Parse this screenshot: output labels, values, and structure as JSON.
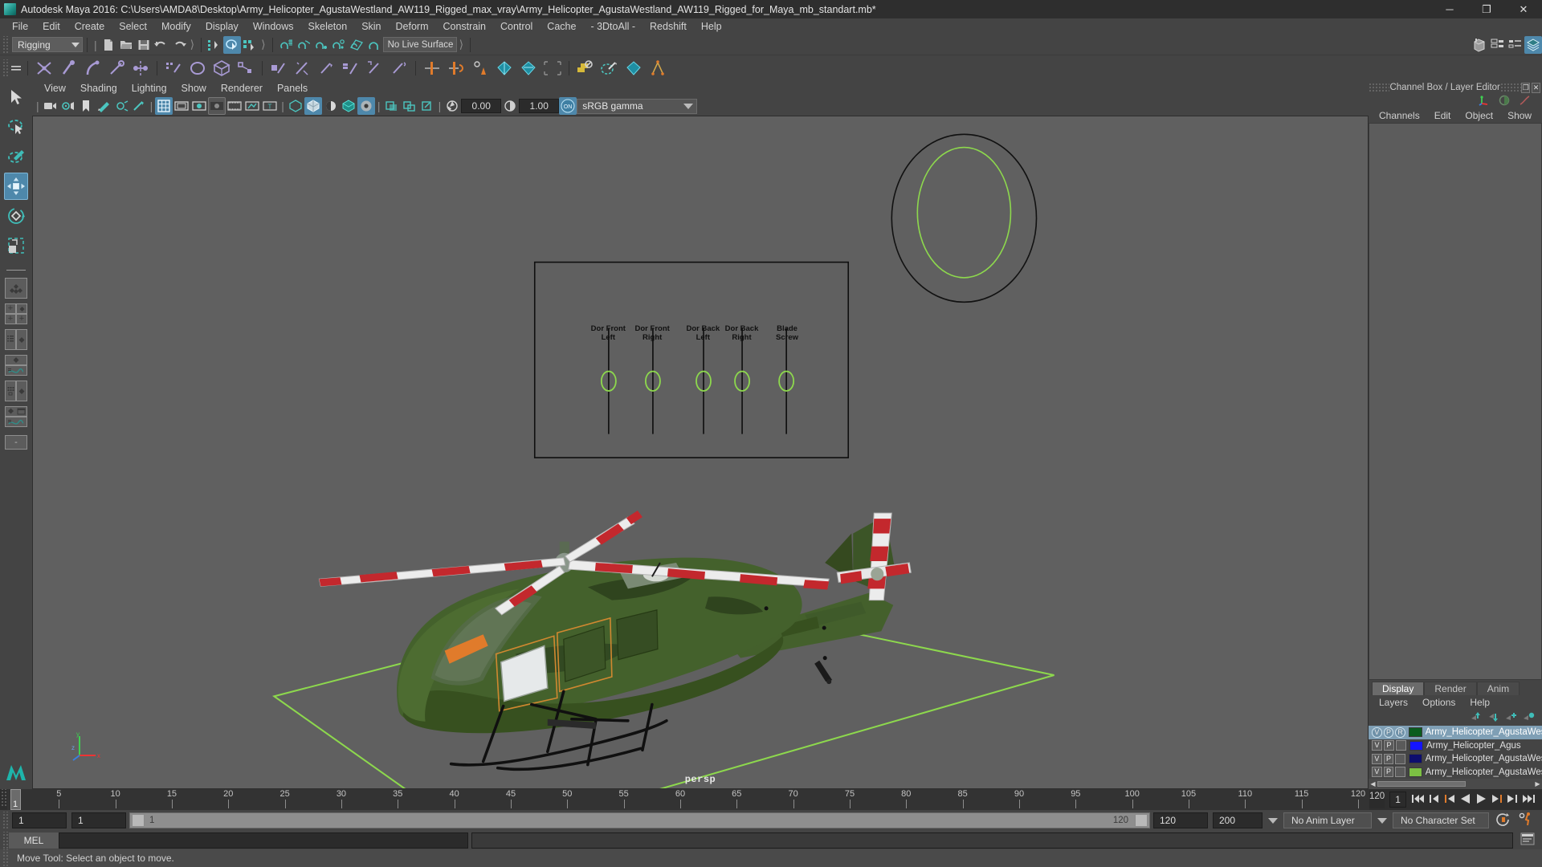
{
  "titlebar": {
    "app_title": "Autodesk Maya 2016: C:\\Users\\AMDA8\\Desktop\\Army_Helicopter_AgustaWestland_AW119_Rigged_max_vray\\Army_Helicopter_AgustaWestland_AW119_Rigged_for_Maya_mb_standart.mb*",
    "minimize": "─",
    "maximize": "❐",
    "close": "✕"
  },
  "menubar": {
    "items": [
      "File",
      "Edit",
      "Create",
      "Select",
      "Modify",
      "Display",
      "Windows",
      "Skeleton",
      "Skin",
      "Deform",
      "Constrain",
      "Control",
      "Cache",
      "- 3DtoAll -",
      "Redshift",
      "Help"
    ]
  },
  "statusline": {
    "menu_set": "Rigging",
    "live_surface": "No Live Surface",
    "icons": [
      "new-scene-icon",
      "open-scene-icon",
      "save-scene-icon",
      "undo-icon",
      "redo-icon",
      "select-by-hierarchy-icon",
      "select-by-object-type-icon",
      "select-by-component-type-icon",
      "snap-to-grid-icon",
      "snap-to-curve-icon",
      "snap-to-point-icon",
      "snap-to-projected-center-icon",
      "snap-to-view-plane-icon",
      "make-live-icon",
      "show-editors-icon",
      "render-view-icon",
      "ipr-render-icon",
      "render-settings-icon",
      "toggle-sidebar-attribute-icon",
      "toggle-sidebar-tool-icon",
      "toggle-sidebar-channel-icon",
      "toggle-sidebar-layer-icon"
    ]
  },
  "shelfbar": {
    "icons": [
      "create-joint-icon",
      "ik-handle-icon",
      "ik-spline-handle-icon",
      "insert-joint-icon",
      "mirror-joint-icon",
      "skeleton-generator-icon",
      "quick-rig-icon",
      "lattice-icon",
      "wrap-icon",
      "cluster-icon",
      "bind-skin-icon",
      "detach-skin-icon",
      "paint-skin-weights-icon",
      "mirror-skin-weights-icon",
      "copy-skin-weights-icon",
      "smooth-skin-icon",
      "parent-constraint-icon",
      "point-constraint-icon",
      "orient-constraint-icon",
      "scale-constraint-icon",
      "aim-constraint-icon",
      "pole-vector-icon",
      "full-body-ik-icon",
      "character-set-icon"
    ]
  },
  "toolbox": {
    "tools": [
      "select-tool",
      "lasso-select-tool",
      "paint-select-tool",
      "move-tool",
      "rotate-tool",
      "scale-tool"
    ],
    "selected_tool": "move-tool",
    "layouts": [
      "single-perspective-layout",
      "four-view-layout",
      "outliner-persp-layout",
      "persp-graph-layout",
      "hypershade-persp-layout",
      "persp-graph-outliner-layout"
    ]
  },
  "viewport_menu": {
    "items": [
      "View",
      "Shading",
      "Lighting",
      "Show",
      "Renderer",
      "Panels"
    ]
  },
  "viewport_toolbar": {
    "exposure_value": "0.00",
    "gamma_value": "1.00",
    "view_transform": "sRGB gamma",
    "color_mgmt_toggle": "ON",
    "icons": [
      "select-camera-icon",
      "camera-attributes-icon",
      "bookmark-icon",
      "image-plane-icon",
      "two-sided-lighting-icon",
      "shadows-icon",
      "grid-icon",
      "film-gate-icon",
      "resolution-gate-icon",
      "gate-mask-icon",
      "film-origin-icon",
      "xray-icon",
      "texture-icon",
      "wireframe-icon",
      "smooth-shade-icon",
      "shaded-and-textured-icon",
      "lights-icon",
      "xray-joints-icon",
      "isolate-select-icon",
      "panel-zoom-icon",
      "ipr-icon"
    ]
  },
  "viewport": {
    "camera_label": "persp",
    "control_panel_labels": [
      {
        "line1": "Dor Front",
        "line2": "Left"
      },
      {
        "line1": "Dor Front",
        "line2": "Right"
      },
      {
        "line1": "Dor Back",
        "line2": "Left"
      },
      {
        "line1": "Dor Back",
        "line2": "Right"
      },
      {
        "line1": "Blade",
        "line2": "Screw"
      }
    ],
    "axis_labels": [
      "y",
      "x",
      "z"
    ],
    "background_color": "#606060",
    "grid_color": "#8dd84d",
    "helicopter_body_color": "#3f5a2a",
    "rotor_stripe_color": "#c3282d"
  },
  "rightpanel": {
    "title": "Channel Box / Layer Editor",
    "undock_label": "❐",
    "close_label": "✕",
    "menus": [
      "Channels",
      "Edit",
      "Object",
      "Show"
    ],
    "layer_tabs": [
      "Display",
      "Render",
      "Anim"
    ],
    "active_layer_tab": "Display",
    "layer_menus": [
      "Layers",
      "Options",
      "Help"
    ],
    "layer_buttons": [
      "move-layer-up-icon",
      "move-layer-down-icon",
      "new-layer-icon",
      "new-layer-from-selected-icon"
    ],
    "layers": [
      {
        "v": "V",
        "p": "P",
        "r": "R",
        "color": "#0a5c1e",
        "name": "Army_Helicopter_AgustaWes",
        "selected": true
      },
      {
        "v": "V",
        "p": "P",
        "r": "",
        "color": "#1414ff",
        "name": "Army_Helicopter_Agus",
        "selected": false
      },
      {
        "v": "V",
        "p": "P",
        "r": "",
        "color": "#0d0d6e",
        "name": "Army_Helicopter_AgustaWes",
        "selected": false
      },
      {
        "v": "V",
        "p": "P",
        "r": "",
        "color": "#7cc043",
        "name": "Army_Helicopter_AgustaWes",
        "selected": false
      }
    ]
  },
  "timeline": {
    "start": 1,
    "end": 120,
    "current_frame": "1",
    "end_label": "120",
    "ticks": [
      5,
      10,
      15,
      20,
      25,
      30,
      35,
      40,
      45,
      50,
      55,
      60,
      65,
      70,
      75,
      80,
      85,
      90,
      95,
      100,
      105,
      110,
      115,
      120
    ],
    "playback_buttons": [
      "go-to-start-icon",
      "step-back-keyframe-icon",
      "step-back-frame-icon",
      "play-backwards-icon",
      "play-forwards-icon",
      "step-forward-frame-icon",
      "step-forward-keyframe-icon",
      "go-to-end-icon"
    ]
  },
  "rangeslider": {
    "anim_start": "1",
    "range_start": "1",
    "slider_left_label": "1",
    "slider_right_label": "120",
    "range_end": "120",
    "anim_end": "200",
    "anim_layer": "No Anim Layer",
    "character_set": "No Character Set",
    "icons": [
      "auto-keyframe-icon",
      "animation-preferences-icon"
    ]
  },
  "commandline": {
    "language": "MEL",
    "input_value": "",
    "script-editor-icon": "script-editor-icon"
  },
  "helpline": {
    "text": "Move Tool: Select an object to move."
  }
}
